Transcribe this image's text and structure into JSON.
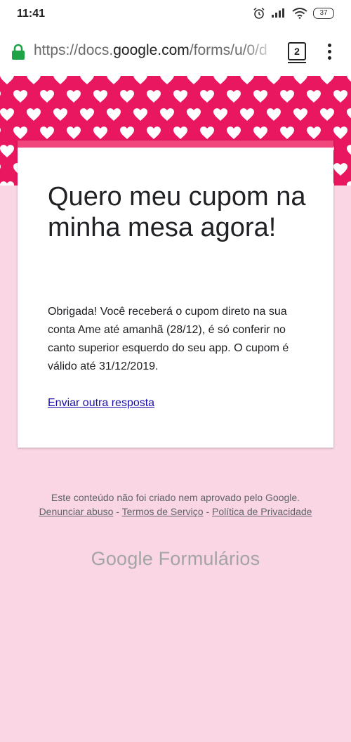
{
  "status_bar": {
    "time": "11:41",
    "battery": "37",
    "icons": [
      "alarm-icon",
      "signal-icon",
      "wifi-icon",
      "battery-icon"
    ]
  },
  "browser": {
    "url_prefix": "https://docs.",
    "url_domain": "google.com",
    "url_suffix": "/forms/u/0/d",
    "tab_count": "2",
    "secure": true
  },
  "form": {
    "title": "Quero meu cupom na minha mesa agora!",
    "message": "Obrigada! Você receberá o cupom direto na sua conta Ame até amanhã (28/12), é só conferir no canto superior esquerdo do seu app. O cupom é válido até 31/12/2019.",
    "another_response_link": "Enviar outra resposta"
  },
  "footer": {
    "disclaimer": "Este conteúdo não foi criado nem aprovado pelo Google.",
    "report_abuse": "Denunciar abuso",
    "separator1": " - ",
    "terms": "Termos de Serviço",
    "separator2": " - ",
    "privacy": "Política de Privacidade",
    "brand_google": "Google",
    "brand_product": "Formulários"
  },
  "colors": {
    "page_background": "#fad6e4",
    "banner_pink": "#e8175f",
    "card_accent": "#f0457d",
    "link_blue": "#1a0dab",
    "lock_green": "#1ea446"
  }
}
